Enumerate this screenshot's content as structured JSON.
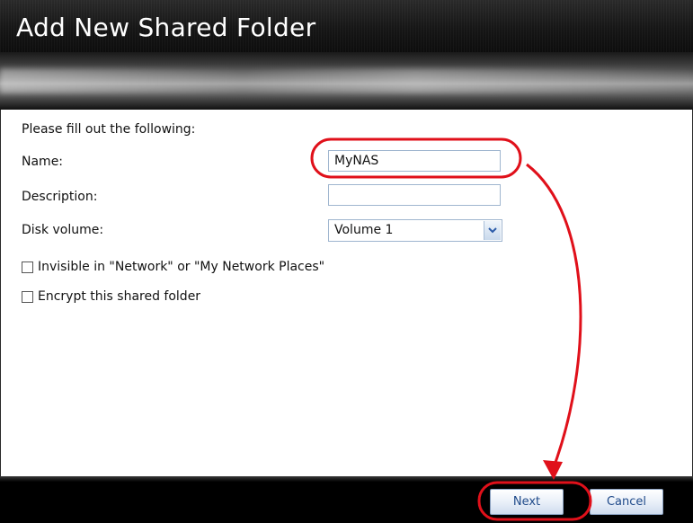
{
  "window": {
    "title": "Add New Shared Folder"
  },
  "form": {
    "intro": "Please fill out the following:",
    "name_label": "Name:",
    "name_value": "MyNAS",
    "description_label": "Description:",
    "description_value": "",
    "disk_volume_label": "Disk volume:",
    "disk_volume_value": "Volume 1",
    "invisible_label": "Invisible in \"Network\" or \"My Network Places\"",
    "invisible_checked": false,
    "encrypt_label": "Encrypt this shared folder",
    "encrypt_checked": false
  },
  "footer": {
    "next_label": "Next",
    "cancel_label": "Cancel"
  },
  "icons": {
    "dropdown": "chevron-down-icon"
  },
  "colors": {
    "annotation": "#e0101a",
    "title_bar": "#141414",
    "button_text": "#1f4a8a"
  }
}
